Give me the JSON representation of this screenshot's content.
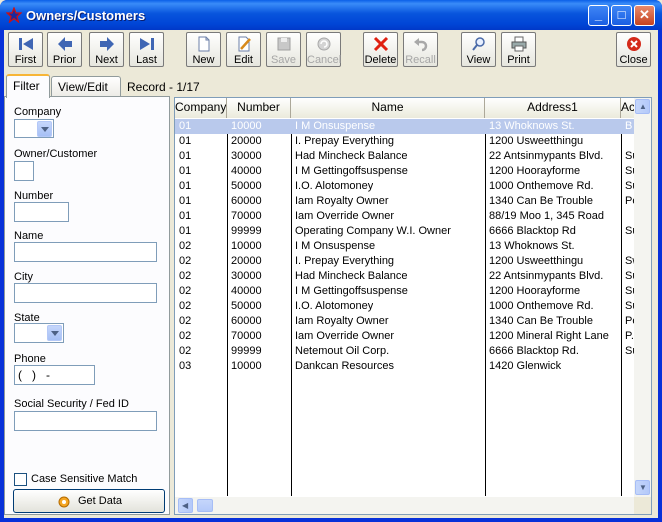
{
  "window": {
    "title": "Owners/Customers",
    "icon": "star-icon"
  },
  "title_buttons": {
    "minimize": "_",
    "maximize": "□",
    "close": "✕"
  },
  "toolbar": [
    {
      "id": "first",
      "label": "First",
      "icon": "first-arrow-icon",
      "enabled": true
    },
    {
      "id": "prior",
      "label": "Prior",
      "icon": "left-arrow-icon",
      "enabled": true
    },
    {
      "id": "next",
      "label": "Next",
      "icon": "right-arrow-icon",
      "enabled": true
    },
    {
      "id": "last",
      "label": "Last",
      "icon": "last-arrow-icon",
      "enabled": true
    },
    {
      "id": "new",
      "label": "New",
      "icon": "new-document-icon",
      "enabled": true
    },
    {
      "id": "edit",
      "label": "Edit",
      "icon": "pencil-icon",
      "enabled": true
    },
    {
      "id": "save",
      "label": "Save",
      "icon": "floppy-icon",
      "enabled": false
    },
    {
      "id": "cancel",
      "label": "Cancel",
      "icon": "cancel-icon",
      "enabled": false
    },
    {
      "id": "delete",
      "label": "Delete",
      "icon": "red-x-icon",
      "enabled": true
    },
    {
      "id": "recall",
      "label": "Recall",
      "icon": "undo-icon",
      "enabled": false
    },
    {
      "id": "view",
      "label": "View",
      "icon": "magnifier-icon",
      "enabled": true
    },
    {
      "id": "print",
      "label": "Print",
      "icon": "printer-icon",
      "enabled": true
    },
    {
      "id": "close",
      "label": "Close",
      "icon": "close-icon",
      "enabled": true
    }
  ],
  "tabs": [
    {
      "label": "Filter",
      "active": true
    },
    {
      "label": "View/Edit",
      "active": false
    }
  ],
  "record_status": "Record - 1/17",
  "filter": {
    "company_label": "Company",
    "owner_label": "Owner/Customer",
    "number_label": "Number",
    "name_label": "Name",
    "city_label": "City",
    "state_label": "State",
    "phone_label": "Phone",
    "phone_value": "(   )   -",
    "ssn_label": "Social Security / Fed ID",
    "case_label": "Case Sensitive Match",
    "getdata_label": "Get Data"
  },
  "grid": {
    "columns": [
      "Company",
      "Number",
      "Name",
      "Address1",
      "Ac"
    ],
    "rows": [
      [
        "01",
        "10000",
        "I M Onsuspense",
        "13 Whoknows St.",
        "B"
      ],
      [
        "01",
        "20000",
        "I. Prepay Everything",
        "1200 Usweetthingu",
        ""
      ],
      [
        "01",
        "30000",
        "Had Mincheck Balance",
        "22 Antsinmypants Blvd.",
        "Su"
      ],
      [
        "01",
        "40000",
        "I M Gettingoffsuspense",
        "1200 Hoorayforme",
        "Su"
      ],
      [
        "01",
        "50000",
        "I.O. Alotomoney",
        "1000 Onthemove Rd.",
        "Su"
      ],
      [
        "01",
        "60000",
        "Iam Royalty Owner",
        "1340 Can Be Trouble",
        "Pe"
      ],
      [
        "01",
        "70000",
        "Iam Override Owner",
        "88/19 Moo 1, 345 Road",
        ""
      ],
      [
        "01",
        "99999",
        "Operating Company W.I.  Owner",
        "6666 Blacktop Rd",
        "Su"
      ],
      [
        "02",
        "10000",
        "I M Onsuspense",
        "13 Whoknows St.",
        ""
      ],
      [
        "02",
        "20000",
        "I. Prepay Everything",
        "1200 Usweetthingu",
        "Sw"
      ],
      [
        "02",
        "30000",
        "Had Mincheck Balance",
        "22 Antsinmypants Blvd.",
        "Su"
      ],
      [
        "02",
        "40000",
        "I M Gettingoffsuspense",
        "1200 Hoorayforme",
        "Su"
      ],
      [
        "02",
        "50000",
        "I.O. Alotomoney",
        "1000 Onthemove Rd.",
        "Su"
      ],
      [
        "02",
        "60000",
        "Iam Royalty Owner",
        "1340 Can Be Trouble",
        "Pe"
      ],
      [
        "02",
        "70000",
        "Iam Override Owner",
        "1200 Mineral Right Lane",
        "P."
      ],
      [
        "02",
        "99999",
        "Netemout Oil Corp.",
        "6666 Blacktop Rd.",
        "Su"
      ],
      [
        "03",
        "10000",
        "Dankcan Resources",
        "1420 Glenwick",
        ""
      ]
    ],
    "selected_row": 0
  },
  "colors": {
    "selection": "#b9c9ec",
    "titlebar": "#0855dd",
    "tab_highlight": "#f7b536"
  }
}
